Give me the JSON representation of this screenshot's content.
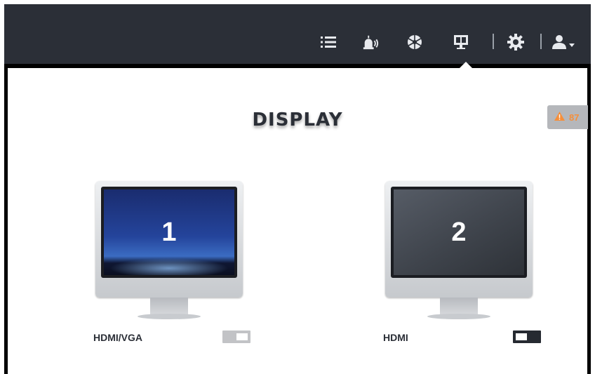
{
  "header": {
    "icons": [
      "list-icon",
      "alarm-icon",
      "aperture-icon",
      "display-icon",
      "gear-icon",
      "user-icon"
    ]
  },
  "panel": {
    "title": "DISPLAY",
    "alert_badge": {
      "icon": "warning-icon",
      "count": "87",
      "color": "#f58f3b"
    }
  },
  "monitors": [
    {
      "number": "1",
      "label": "HDMI/VGA",
      "toggle": "off"
    },
    {
      "number": "2",
      "label": "HDMI",
      "toggle": "on"
    }
  ],
  "colors": {
    "header_bg": "#2b2f37",
    "accent_warning": "#f58f3b"
  }
}
